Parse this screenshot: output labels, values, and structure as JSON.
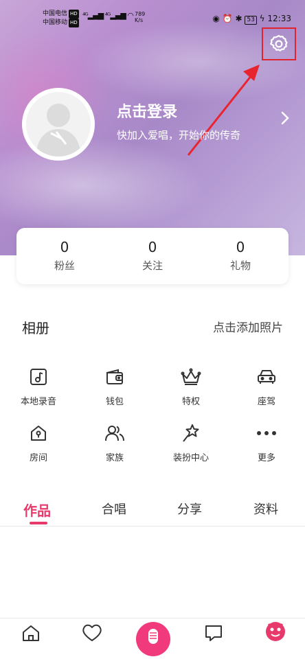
{
  "status_bar": {
    "carrier1": "中国电信",
    "carrier2": "中国移动",
    "hd": "HD",
    "speed_value": "789",
    "speed_unit": "K/s",
    "battery": "53",
    "time": "12:33"
  },
  "profile": {
    "login_title": "点击登录",
    "login_subtitle": "快加入爱唱，开始你的传奇"
  },
  "stats": [
    {
      "value": "0",
      "label": "粉丝"
    },
    {
      "value": "0",
      "label": "关注"
    },
    {
      "value": "0",
      "label": "礼物"
    }
  ],
  "album": {
    "title": "相册",
    "add_label": "点击添加照片"
  },
  "features": [
    {
      "label": "本地录音",
      "icon": "music-note-icon"
    },
    {
      "label": "钱包",
      "icon": "wallet-icon"
    },
    {
      "label": "特权",
      "icon": "crown-icon"
    },
    {
      "label": "座驾",
      "icon": "car-icon"
    },
    {
      "label": "房间",
      "icon": "house-icon"
    },
    {
      "label": "家族",
      "icon": "family-icon"
    },
    {
      "label": "装扮中心",
      "icon": "star-wand-icon"
    },
    {
      "label": "更多",
      "icon": "more-dots-icon"
    }
  ],
  "tabs": [
    {
      "label": "作品",
      "active": true
    },
    {
      "label": "合唱",
      "active": false
    },
    {
      "label": "分享",
      "active": false
    },
    {
      "label": "资料",
      "active": false
    }
  ],
  "bottom_nav": [
    {
      "icon": "home-icon"
    },
    {
      "icon": "heart-icon"
    },
    {
      "icon": "microphone-icon"
    },
    {
      "icon": "message-icon"
    },
    {
      "icon": "profile-icon"
    }
  ],
  "colors": {
    "accent": "#e8396b",
    "highlight_box": "#e0232e"
  }
}
